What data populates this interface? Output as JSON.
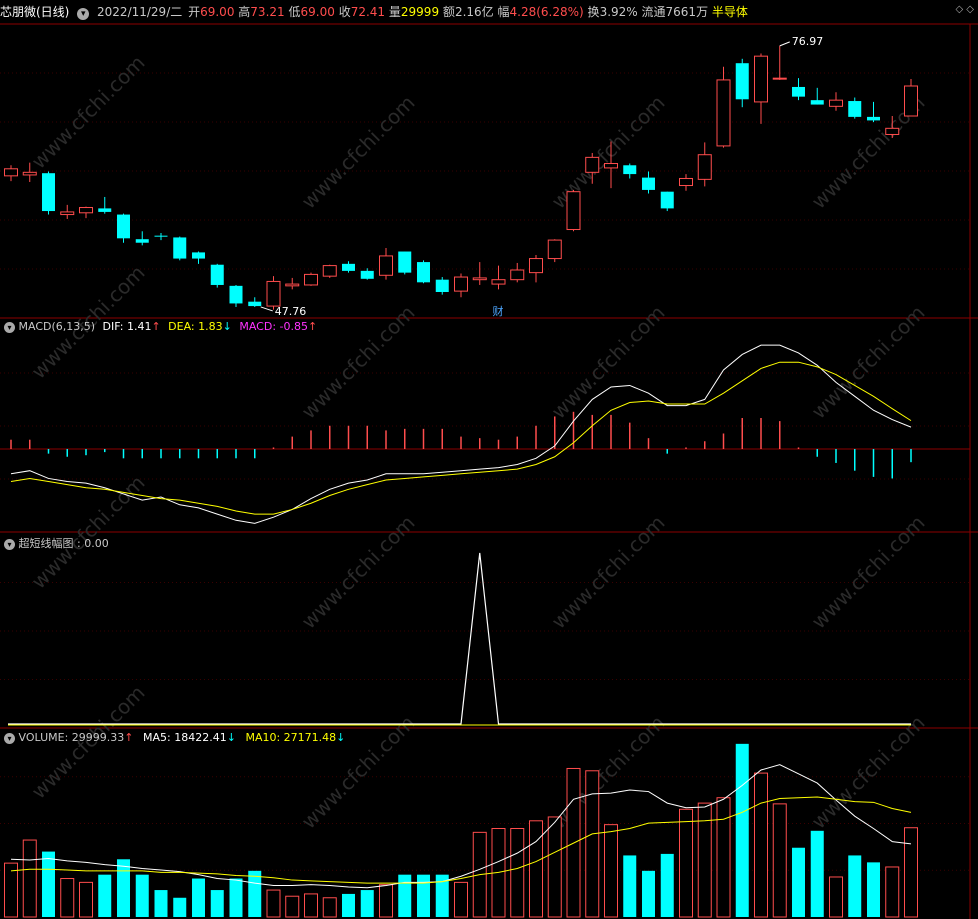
{
  "header": {
    "stock_name": "芯朋微(日线)",
    "date": "2022/11/29/二",
    "open_label": "开",
    "open": "69.00",
    "high_label": "高",
    "high": "73.21",
    "low_label": "低",
    "low": "69.00",
    "close_label": "收",
    "close": "72.41",
    "vol_label": "量",
    "vol": "29999",
    "amount_label": "额",
    "amount": "2.16亿",
    "amp_label": "幅",
    "amp": "4.28(6.28%)",
    "turnover_label": "换",
    "turnover": "3.92%",
    "float_label": "流通",
    "float": "7661万",
    "sector": "半导体"
  },
  "price_panel": {
    "max_label": "76.97",
    "min_label": "47.76",
    "event_marker": "财"
  },
  "macd_panel": {
    "title": "MACD(6,13,5)",
    "dif_label": "DIF:",
    "dif": "1.41",
    "dea_label": "DEA:",
    "dea": "1.83",
    "macd_label": "MACD:",
    "macd": "-0.85"
  },
  "amp_panel": {
    "title": "超短线幅图",
    "value": ": 0.00"
  },
  "volume_panel": {
    "title": "VOLUME:",
    "value": "29999.33",
    "ma5_label": "MA5:",
    "ma5": "18422.41",
    "ma10_label": "MA10:",
    "ma10": "27171.48"
  },
  "watermark": "www.cfchi.com",
  "colors": {
    "up": "#ff4d4d",
    "down": "#00ffff",
    "white_line": "#ffffff",
    "yellow_line": "#ffff00",
    "magenta": "#ff33ff",
    "grid": "#8b0000"
  },
  "chart_data": {
    "type": "candlestick",
    "candles": [
      {
        "o": 62.2,
        "h": 63.4,
        "l": 61.6,
        "c": 63.0
      },
      {
        "o": 62.3,
        "h": 63.7,
        "l": 61.5,
        "c": 62.6
      },
      {
        "o": 62.5,
        "h": 62.7,
        "l": 57.8,
        "c": 58.2
      },
      {
        "o": 57.8,
        "h": 58.9,
        "l": 57.3,
        "c": 58.1
      },
      {
        "o": 58.0,
        "h": 58.7,
        "l": 57.4,
        "c": 58.6
      },
      {
        "o": 58.5,
        "h": 59.8,
        "l": 57.9,
        "c": 58.1
      },
      {
        "o": 57.8,
        "h": 57.9,
        "l": 54.6,
        "c": 55.1
      },
      {
        "o": 55.0,
        "h": 55.9,
        "l": 54.3,
        "c": 54.6
      },
      {
        "o": 55.4,
        "h": 55.7,
        "l": 54.9,
        "c": 55.3
      },
      {
        "o": 55.2,
        "h": 55.3,
        "l": 52.6,
        "c": 52.8
      },
      {
        "o": 53.5,
        "h": 53.6,
        "l": 52.2,
        "c": 52.8
      },
      {
        "o": 52.1,
        "h": 52.2,
        "l": 49.5,
        "c": 49.8
      },
      {
        "o": 49.7,
        "h": 49.8,
        "l": 47.3,
        "c": 47.7
      },
      {
        "o": 47.9,
        "h": 48.4,
        "l": 47.3,
        "c": 47.4
      },
      {
        "o": 47.4,
        "h": 50.8,
        "l": 47.0,
        "c": 50.2
      },
      {
        "o": 49.7,
        "h": 50.6,
        "l": 49.3,
        "c": 49.9
      },
      {
        "o": 49.8,
        "h": 51.2,
        "l": 49.7,
        "c": 51.0
      },
      {
        "o": 50.8,
        "h": 52.1,
        "l": 50.6,
        "c": 52.0
      },
      {
        "o": 52.2,
        "h": 52.5,
        "l": 51.2,
        "c": 51.4
      },
      {
        "o": 51.4,
        "h": 51.7,
        "l": 50.4,
        "c": 50.5
      },
      {
        "o": 50.9,
        "h": 54.0,
        "l": 50.4,
        "c": 53.1
      },
      {
        "o": 53.6,
        "h": 53.6,
        "l": 51.0,
        "c": 51.2
      },
      {
        "o": 52.4,
        "h": 52.6,
        "l": 50.0,
        "c": 50.1
      },
      {
        "o": 50.4,
        "h": 50.7,
        "l": 48.7,
        "c": 49.0
      },
      {
        "o": 49.1,
        "h": 51.1,
        "l": 48.4,
        "c": 50.7
      },
      {
        "o": 50.4,
        "h": 52.4,
        "l": 49.8,
        "c": 50.6
      },
      {
        "o": 49.9,
        "h": 52.0,
        "l": 49.3,
        "c": 50.4
      },
      {
        "o": 50.4,
        "h": 52.3,
        "l": 50.1,
        "c": 51.5
      },
      {
        "o": 51.2,
        "h": 53.2,
        "l": 50.1,
        "c": 52.8
      },
      {
        "o": 52.8,
        "h": 55.0,
        "l": 52.4,
        "c": 54.9
      },
      {
        "o": 56.1,
        "h": 60.6,
        "l": 55.9,
        "c": 60.4
      },
      {
        "o": 62.6,
        "h": 64.8,
        "l": 61.3,
        "c": 64.3
      },
      {
        "o": 63.1,
        "h": 66.1,
        "l": 60.8,
        "c": 63.6
      },
      {
        "o": 63.4,
        "h": 63.6,
        "l": 61.9,
        "c": 62.4
      },
      {
        "o": 62.0,
        "h": 62.7,
        "l": 60.2,
        "c": 60.6
      },
      {
        "o": 60.4,
        "h": 60.4,
        "l": 58.2,
        "c": 58.5
      },
      {
        "o": 61.1,
        "h": 62.4,
        "l": 60.5,
        "c": 61.9
      },
      {
        "o": 61.8,
        "h": 66.0,
        "l": 61.0,
        "c": 64.6
      },
      {
        "o": 65.6,
        "h": 74.6,
        "l": 65.4,
        "c": 73.1
      },
      {
        "o": 75.0,
        "h": 75.5,
        "l": 70.0,
        "c": 70.9
      },
      {
        "o": 70.6,
        "h": 76.1,
        "l": 68.1,
        "c": 75.8
      },
      {
        "o": 73.2,
        "h": 76.97,
        "l": 73.1,
        "c": 73.3
      },
      {
        "o": 72.3,
        "h": 73.3,
        "l": 70.8,
        "c": 71.2
      },
      {
        "o": 70.8,
        "h": 72.2,
        "l": 70.3,
        "c": 70.3
      },
      {
        "o": 70.1,
        "h": 71.7,
        "l": 69.6,
        "c": 70.8
      },
      {
        "o": 70.7,
        "h": 71.1,
        "l": 68.7,
        "c": 68.9
      },
      {
        "o": 68.9,
        "h": 70.6,
        "l": 68.3,
        "c": 68.5
      },
      {
        "o": 66.9,
        "h": 69.0,
        "l": 66.5,
        "c": 67.6
      },
      {
        "o": 69.0,
        "h": 73.21,
        "l": 69.0,
        "c": 72.41
      }
    ],
    "macd_hist": [
      0.6,
      0.6,
      -0.3,
      -0.5,
      -0.4,
      -0.2,
      -0.6,
      -0.6,
      -0.6,
      -0.6,
      -0.6,
      -0.6,
      -0.6,
      -0.6,
      0.1,
      0.8,
      1.2,
      1.5,
      1.5,
      1.5,
      1.2,
      1.3,
      1.3,
      1.3,
      0.8,
      0.7,
      0.6,
      0.8,
      1.5,
      2.1,
      2.4,
      2.2,
      2.2,
      1.7,
      0.7,
      -0.3,
      0.1,
      0.5,
      1.0,
      2.0,
      2.0,
      1.8,
      0.1,
      -0.5,
      -0.9,
      -1.4,
      -1.8,
      -1.9,
      -0.85
    ],
    "dif": [
      -1.6,
      -1.4,
      -1.9,
      -2.1,
      -2.2,
      -2.5,
      -2.9,
      -3.3,
      -3.1,
      -3.6,
      -3.8,
      -4.2,
      -4.6,
      -4.8,
      -4.4,
      -3.9,
      -3.2,
      -2.6,
      -2.2,
      -2.0,
      -1.6,
      -1.6,
      -1.6,
      -1.5,
      -1.4,
      -1.3,
      -1.2,
      -1.0,
      -0.6,
      0.2,
      1.8,
      3.2,
      4.0,
      4.1,
      3.6,
      2.8,
      2.8,
      3.2,
      5.1,
      6.1,
      6.7,
      6.7,
      6.2,
      5.4,
      4.3,
      3.4,
      2.5,
      1.9,
      1.41
    ],
    "dea": [
      -2.1,
      -1.9,
      -2.1,
      -2.3,
      -2.5,
      -2.6,
      -2.8,
      -3.0,
      -3.2,
      -3.3,
      -3.5,
      -3.7,
      -4.0,
      -4.2,
      -4.2,
      -3.9,
      -3.5,
      -3.0,
      -2.6,
      -2.3,
      -2.0,
      -1.9,
      -1.8,
      -1.7,
      -1.6,
      -1.5,
      -1.4,
      -1.3,
      -1.0,
      -0.5,
      0.4,
      1.5,
      2.5,
      3.0,
      3.1,
      2.9,
      2.9,
      2.9,
      3.6,
      4.4,
      5.2,
      5.6,
      5.6,
      5.3,
      4.8,
      4.1,
      3.4,
      2.6,
      1.83
    ],
    "amp_line": [
      0,
      0,
      0,
      0,
      0,
      0,
      0,
      0,
      0,
      0,
      0,
      0,
      0,
      0,
      0,
      0,
      0,
      0,
      0,
      0,
      0,
      0,
      0,
      0,
      0,
      1,
      0,
      0,
      0,
      0,
      0,
      0,
      0,
      0,
      0,
      0,
      0,
      0,
      0,
      0,
      0,
      0,
      0,
      0,
      0,
      0,
      0,
      0,
      0
    ],
    "volume": [
      7000,
      10000,
      8500,
      5000,
      4500,
      5500,
      7500,
      5500,
      3500,
      2500,
      5000,
      3500,
      5000,
      6000,
      3500,
      2700,
      3000,
      2500,
      3000,
      3500,
      4200,
      5500,
      5500,
      5500,
      4500,
      11000,
      11500,
      11500,
      12500,
      13000,
      19300,
      19000,
      12000,
      8000,
      6000,
      8200,
      14000,
      14800,
      15500,
      22500,
      18700,
      14700,
      9000,
      11200,
      5200,
      8000,
      7100,
      6500,
      11600
    ],
    "ma5_vol": [
      7500,
      7400,
      7600,
      7300,
      7100,
      6800,
      6600,
      6300,
      6100,
      5900,
      5500,
      5000,
      4800,
      4400,
      4100,
      4100,
      4200,
      4100,
      3900,
      3800,
      4100,
      4500,
      4500,
      4600,
      5300,
      6200,
      7200,
      8300,
      9800,
      12300,
      15300,
      16000,
      16100,
      16500,
      16300,
      14800,
      14200,
      14300,
      15300,
      17100,
      19100,
      19800,
      18600,
      17400,
      15200,
      13100,
      11500,
      9800,
      9500
    ],
    "ma10_vol": [
      6000,
      6200,
      6200,
      6100,
      6000,
      6000,
      6000,
      6000,
      5800,
      5800,
      5700,
      5600,
      5400,
      5300,
      5100,
      4800,
      4700,
      4600,
      4500,
      4400,
      4400,
      4400,
      4400,
      4600,
      5000,
      5500,
      5800,
      6300,
      7200,
      8400,
      9600,
      10800,
      11100,
      11500,
      12200,
      12300,
      12400,
      12500,
      12700,
      13600,
      14800,
      15400,
      15500,
      15600,
      15300,
      15000,
      14900,
      14100,
      13600
    ]
  }
}
